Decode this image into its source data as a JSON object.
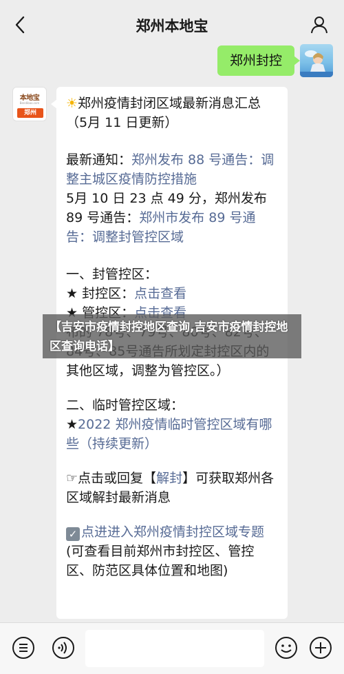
{
  "header": {
    "title": "郑州本地宝",
    "back_icon": "chevron-left-icon",
    "profile_icon": "person-icon"
  },
  "outgoing_message": {
    "text": "郑州封控"
  },
  "bot_avatar": {
    "brand": "本地宝",
    "brand_sub": "Bendibao.com",
    "city_tag": "郑州"
  },
  "reply": {
    "headline_icon": "☀",
    "headline": "郑州疫情封闭区域最新消息汇总（5月 11 日更新）",
    "latest_label": "最新通知：",
    "latest_link": "郑州发布 88 号通告：调整主城区疫情防控措施",
    "may10_text": "5月 10 日 23 点 49 分，郑州发布 89 号通告：",
    "may10_link": "郑州市发布 89 号通告：调整封管控区域",
    "section1_title": "一、封管控区：",
    "star1_label": "★ 封控区：",
    "star1_link": "点击查看",
    "star2_label": "★ 管控区：",
    "star2_link": "点击查看",
    "section1_note": "布的 78号、79号、80号、82号、84号、85号通告所划定封控区内的其他区域，调整为管控区。）",
    "section2_title": "二、临时管控区域：",
    "section2_star": "★",
    "section2_link": "2022 郑州疫情临时管控区域有哪些（持续更新）",
    "tap_icon": "☞",
    "tap_text_before": "点击或回复【",
    "tap_keyword": "解封",
    "tap_text_after": "】可获取郑州各区域解封最新消息",
    "check_icon": "✓",
    "topic_link": "点进进入郑州疫情封控区域专题",
    "topic_note": "(可查看目前郑州市封控区、管控区、防范区具体位置和地图)"
  },
  "overlay": {
    "text": "【吉安市疫情封控地区查询,吉安市疫情封控地区查询电话】"
  },
  "bottombar": {
    "menu_icon": "list-menu-icon",
    "voice_icon": "voice-icon",
    "emoji_icon": "emoji-icon",
    "plus_icon": "plus-icon"
  },
  "colors": {
    "bubble_out": "#95ec69",
    "link": "#576b95",
    "background": "#ededed"
  }
}
